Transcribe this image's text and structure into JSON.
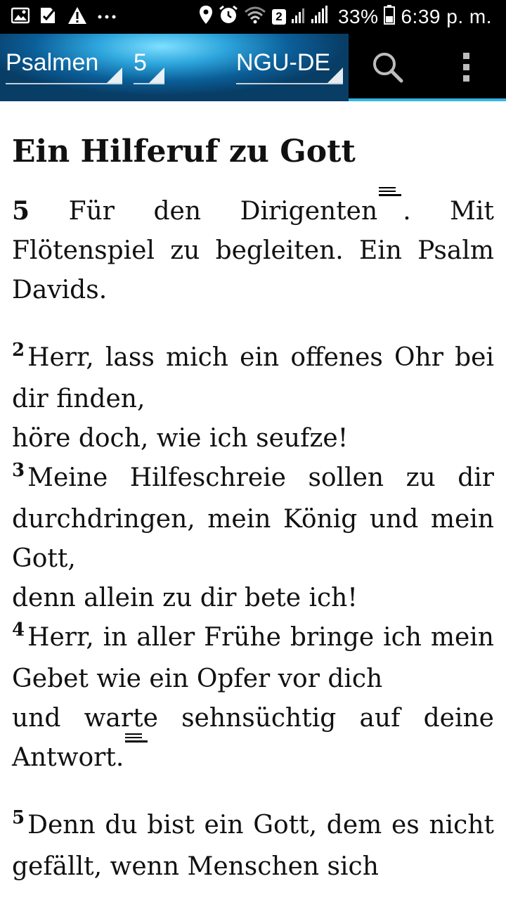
{
  "status_bar": {
    "icons_left": [
      "image-icon",
      "check-icon",
      "warning-icon",
      "more-dots-icon"
    ],
    "icons_right": [
      "location-icon",
      "alarm-icon",
      "wifi-icon",
      "signal-icon",
      "battery-icon"
    ],
    "sim_badge": "2",
    "battery": "33%",
    "time": "6:39 p. m."
  },
  "toolbar": {
    "book": "Psalmen",
    "chapter": "5",
    "version": "NGU-DE",
    "icons": [
      "search-icon",
      "overflow-menu-icon"
    ]
  },
  "passage": {
    "heading": "Ein Hilferuf zu Gott",
    "p1": {
      "verse": "5",
      "text_a": "Für den Dirigenten",
      "text_b": ". Mit Flötenspiel zu begleiten. Ein Psalm Davids."
    },
    "p2": {
      "v2_num": "2",
      "v2_line1": "Herr, lass mich ein offenes Ohr bei dir finden,",
      "v2_line2": "höre doch, wie ich seufze!",
      "v3_num": "3",
      "v3_line1": "Meine Hilfeschreie sollen zu dir durchdringen, mein König und mein Gott,",
      "v3_line2": "denn allein zu dir bete ich!",
      "v4_num": "4",
      "v4_line1": "Herr, in aller Frühe bringe ich mein Gebet wie ein Opfer vor dich",
      "v4_line2": "und warte sehnsüchtig auf deine Antwort."
    },
    "p3": {
      "v5_num": "5",
      "v5_text": "Denn du bist ein Gott, dem es nicht gefällt, wenn Menschen sich"
    }
  }
}
